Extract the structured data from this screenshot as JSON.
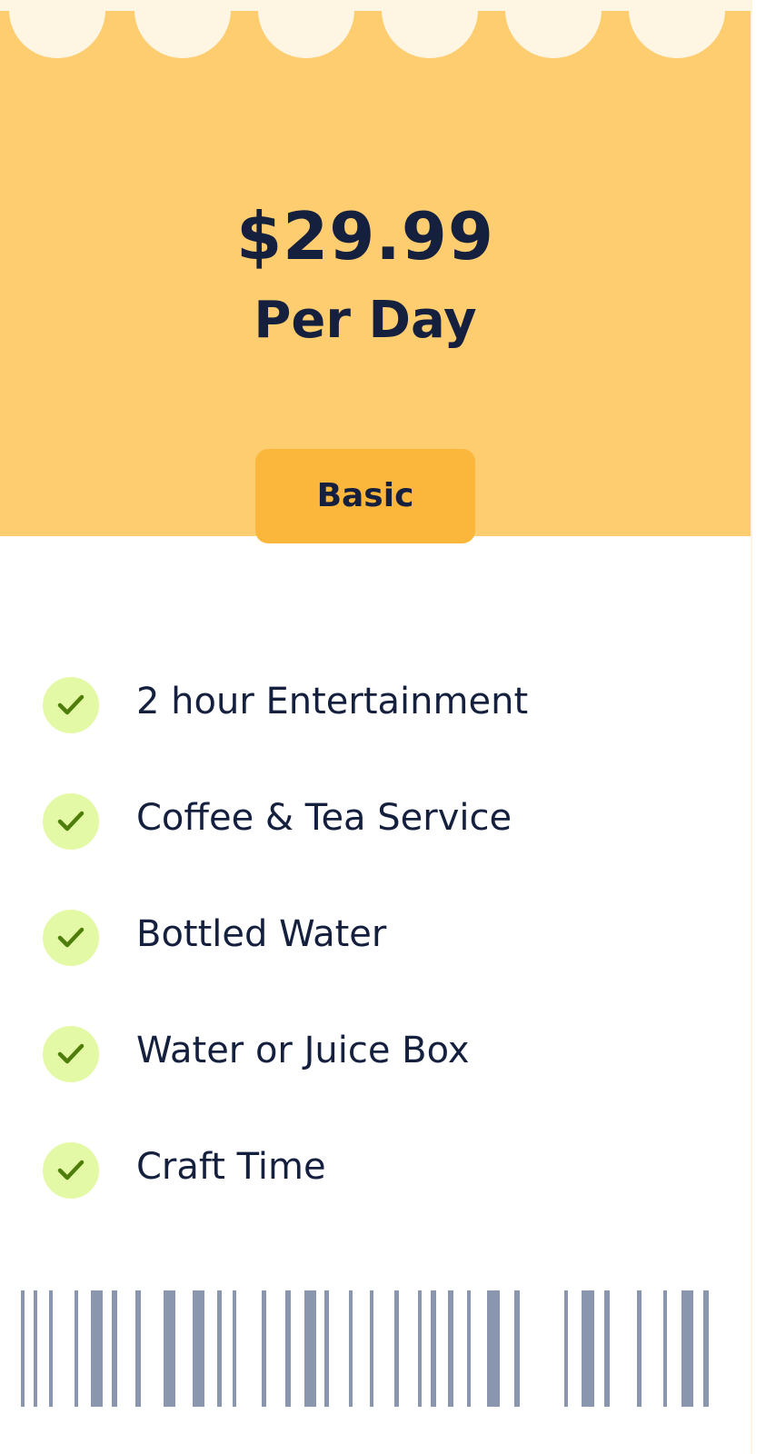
{
  "pricing_card": {
    "price": "$29.99",
    "period": "Per Day",
    "plan_button_label": "Basic",
    "features": [
      {
        "label": "2 hour Entertainment",
        "icon": "check-icon"
      },
      {
        "label": "Coffee & Tea Service",
        "icon": "check-icon"
      },
      {
        "label": "Bottled Water",
        "icon": "check-icon"
      },
      {
        "label": "Water or Juice Box",
        "icon": "check-icon"
      },
      {
        "label": "Craft Time",
        "icon": "check-icon"
      }
    ],
    "barcode": {
      "icon": "barcode-graphic"
    }
  },
  "colors": {
    "header_background": "#fdcd6f",
    "scallop": "#fef5e2",
    "button_background": "#fbb73c",
    "text": "#15203f",
    "check_circle": "#e4f9a5",
    "check_mark": "#4f7d0c",
    "barcode": "#8a95ae"
  }
}
